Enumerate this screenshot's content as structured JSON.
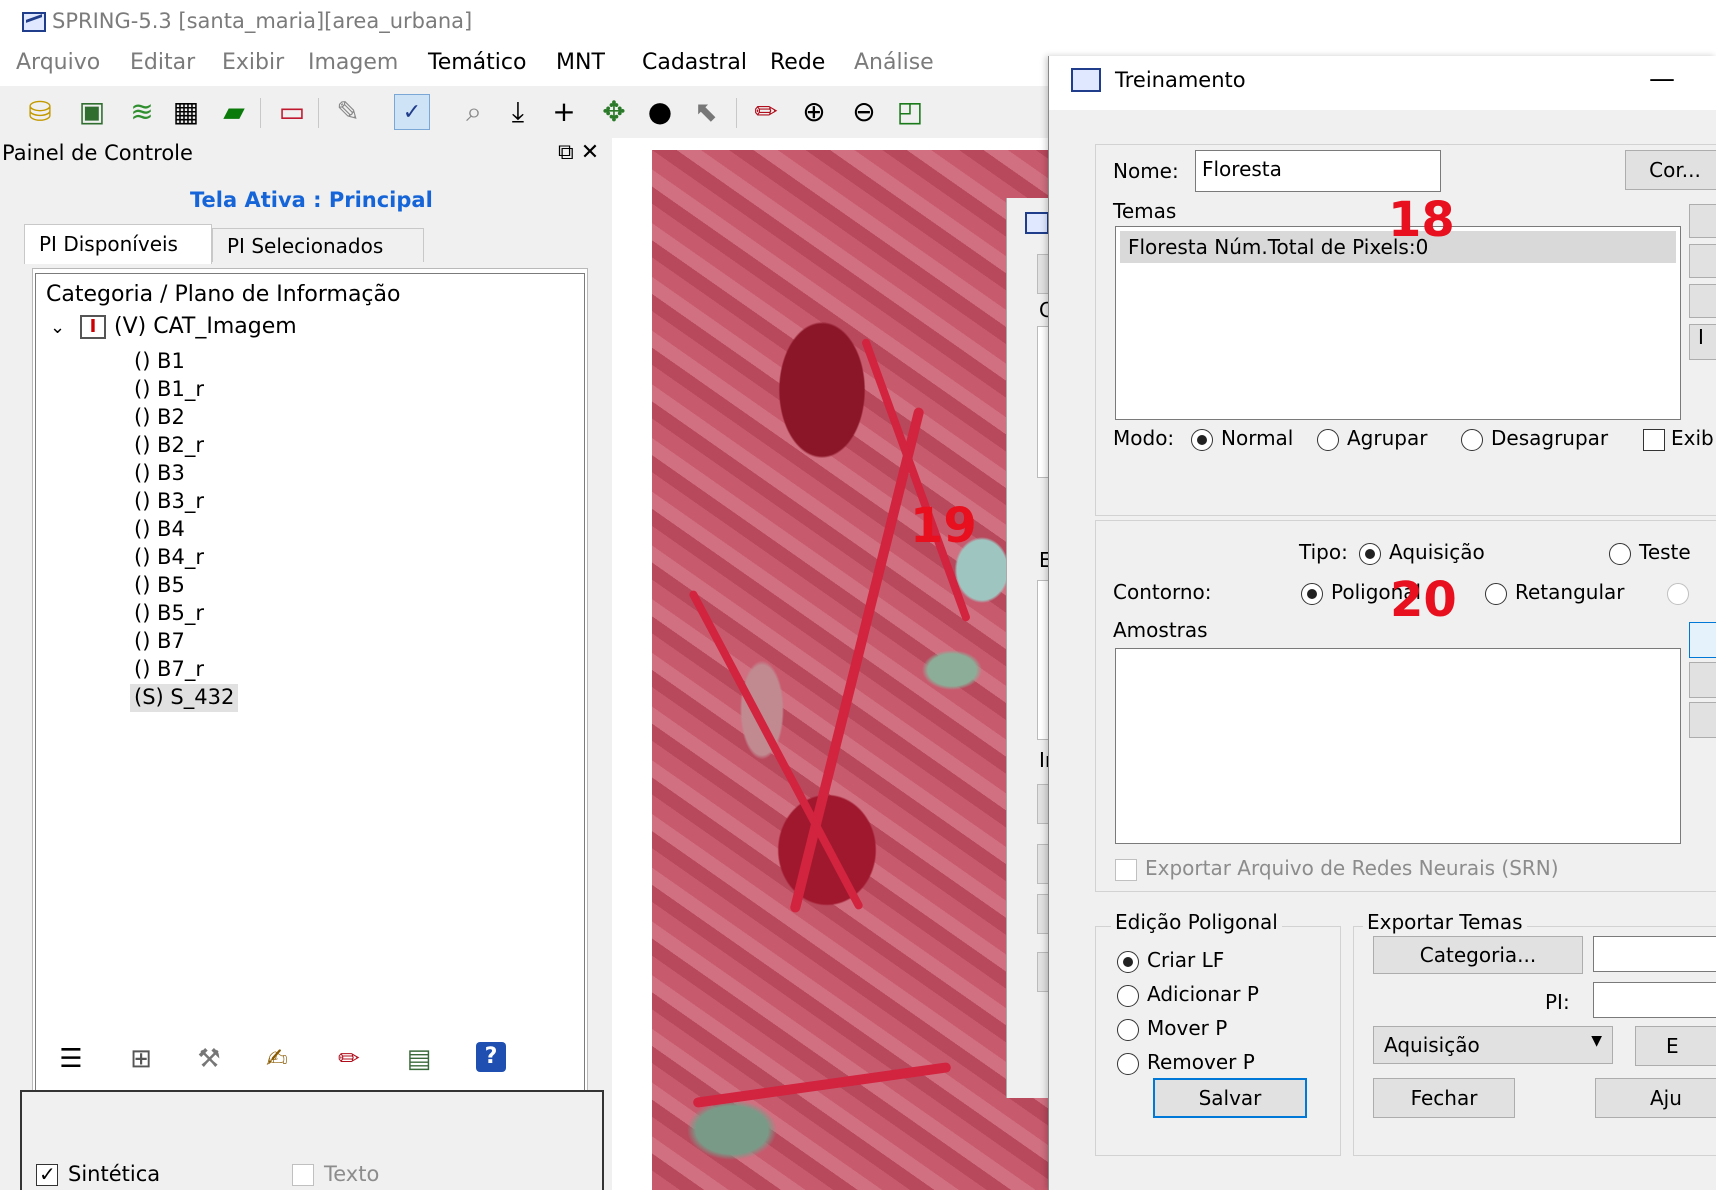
{
  "window": {
    "title": "SPRING-5.3 [santa_maria][area_urbana]"
  },
  "menu": [
    "Arquivo",
    "Editar",
    "Exibir",
    "Imagem",
    "Temático",
    "MNT",
    "Cadastral",
    "Rede",
    "Análise"
  ],
  "toolbar_icons": [
    "database-icon",
    "image-layer-icon",
    "stack-icon",
    "grid-icon",
    "parallelogram-icon",
    "rectangle-icon",
    "pointer-icon",
    "classification-icon",
    "zoom-pointer-icon",
    "drop-icon",
    "crosshair-icon",
    "pan-icon",
    "info-icon",
    "cursor-icon",
    "pencil-icon",
    "zoom-in-icon",
    "zoom-out-icon",
    "zoom-area-icon"
  ],
  "panel": {
    "title": "Painel de Controle",
    "active_screen": "Tela Ativa : Principal",
    "tabs": [
      "PI Disponíveis",
      "PI Selecionados"
    ],
    "tree_header": "Categoria / Plano de Informação",
    "root": "(V) CAT_Imagem",
    "root_icon_letter": "I",
    "items": [
      "() B1",
      "() B1_r",
      "() B2",
      "() B2_r",
      "() B3",
      "() B3_r",
      "() B4",
      "() B4_r",
      "() B5",
      "() B5_r",
      "() B7",
      "() B7_r",
      "(S) S_432"
    ],
    "selected_item": "(S) S_432",
    "bottom_checks": {
      "sintetica": "Sintética",
      "texto": "Texto"
    },
    "tool_icons": [
      "list-icon",
      "table-icon",
      "tools-icon",
      "edit-icon",
      "pencil-icon",
      "legend-icon",
      "help-icon"
    ]
  },
  "hidden_dialog": {
    "letters": [
      "C",
      "E",
      "Ir"
    ]
  },
  "dialog": {
    "title": "Treinamento",
    "minimize": "—",
    "nome_label": "Nome:",
    "nome_value": "Floresta",
    "cor_button": "Cor...",
    "temas_label": "Temas",
    "temas_row": "Floresta    Núm.Total de Pixels:0",
    "side_letter": "I",
    "modo": {
      "label": "Modo:",
      "options": [
        "Normal",
        "Agrupar",
        "Desagrupar"
      ],
      "selected": "Normal",
      "exibir": "Exib"
    },
    "tipo": {
      "label": "Tipo:",
      "options": [
        "Aquisição",
        "Teste"
      ],
      "selected": "Aquisição"
    },
    "contorno": {
      "label": "Contorno:",
      "options": [
        "Poligonal",
        "Retangular"
      ],
      "selected": "Poligonal"
    },
    "amostras_label": "Amostras",
    "exportar_srn": "Exportar Arquivo de Redes Neurais (SRN)",
    "edicao": {
      "label": "Edição Poligonal",
      "options": [
        "Criar LF",
        "Adicionar P",
        "Mover P",
        "Remover P"
      ],
      "selected": "Criar LF"
    },
    "exportar_temas": {
      "label": "Exportar Temas",
      "categoria_button": "Categoria...",
      "pi_label": "PI:",
      "combo_value": "Aquisição",
      "cut_button": "E"
    },
    "buttons": {
      "salvar": "Salvar",
      "fechar": "Fechar",
      "ajuda": "Aju"
    }
  },
  "annotations": [
    "18",
    "19",
    "20"
  ],
  "colors": {
    "accent": "#1565d8",
    "annotation": "#e8101e",
    "vegetation": "#c85a6e"
  }
}
